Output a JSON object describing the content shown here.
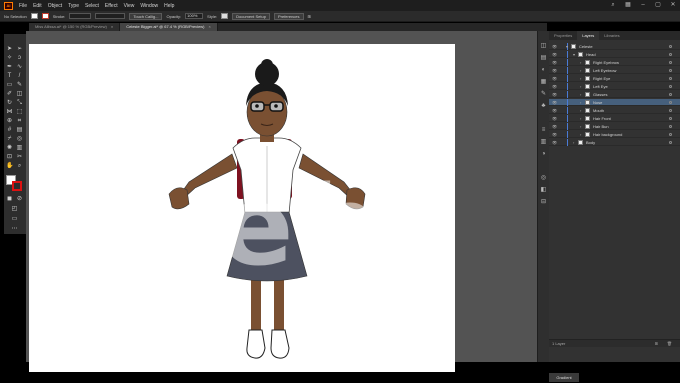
{
  "menubar": {
    "logo": "Ai",
    "items": [
      "File",
      "Edit",
      "Object",
      "Type",
      "Select",
      "Effect",
      "View",
      "Window",
      "Help"
    ]
  },
  "controlbar": {
    "selection_label": "No Selection",
    "stroke_label": "Stroke:",
    "brush_label": "Touch Callig...",
    "opacity_label": "Opacity:",
    "opacity_value": "100%",
    "style_label": "Style:",
    "document_setup": "Document Setup",
    "preferences": "Preferences"
  },
  "tabs": [
    {
      "label": "Miss Allissa.ai* @ 150 % (RGB/Preview)",
      "active": false
    },
    {
      "label": "Celeste Bigger.ai* @ 67.4 % (RGB/Preview)",
      "active": true
    }
  ],
  "panels": {
    "properties": "Properties",
    "layers": "Layers",
    "libraries": "Libraries"
  },
  "layers": [
    {
      "name": "Celeste",
      "indent": 0,
      "expanded": true,
      "selected": false,
      "color": "#4a7bd6"
    },
    {
      "name": "Head",
      "indent": 1,
      "expanded": true,
      "selected": false,
      "color": "#4a7bd6"
    },
    {
      "name": "Right Eyebrow",
      "indent": 2,
      "selected": false,
      "color": "#4a7bd6"
    },
    {
      "name": "Left Eyebrow",
      "indent": 2,
      "selected": false,
      "color": "#4a7bd6"
    },
    {
      "name": "Right Eye",
      "indent": 2,
      "selected": false,
      "color": "#4a7bd6"
    },
    {
      "name": "Left Eye",
      "indent": 2,
      "selected": false,
      "color": "#4a7bd6"
    },
    {
      "name": "Glasses",
      "indent": 2,
      "selected": false,
      "color": "#4a7bd6"
    },
    {
      "name": "Nose",
      "indent": 2,
      "selected": true,
      "color": "#4a7bd6"
    },
    {
      "name": "Mouth",
      "indent": 2,
      "selected": false,
      "color": "#4a7bd6"
    },
    {
      "name": "Hair Front",
      "indent": 2,
      "selected": false,
      "color": "#4a7bd6"
    },
    {
      "name": "Hair Bun",
      "indent": 2,
      "selected": false,
      "color": "#4a7bd6"
    },
    {
      "name": "Hair background",
      "indent": 2,
      "selected": false,
      "color": "#4a7bd6"
    },
    {
      "name": "Body",
      "indent": 1,
      "selected": false,
      "color": "#4a7bd6"
    }
  ],
  "layers_footer": "1 Layer",
  "status_tab": "Gradient",
  "watermark": "eh",
  "colors": {
    "skin": "#7a5032",
    "shirt": "#ffffff",
    "backpack": "#7e1120",
    "skirt": "#4d5160",
    "hair": "#1a1a1a",
    "accent_selection": "#46607d"
  }
}
